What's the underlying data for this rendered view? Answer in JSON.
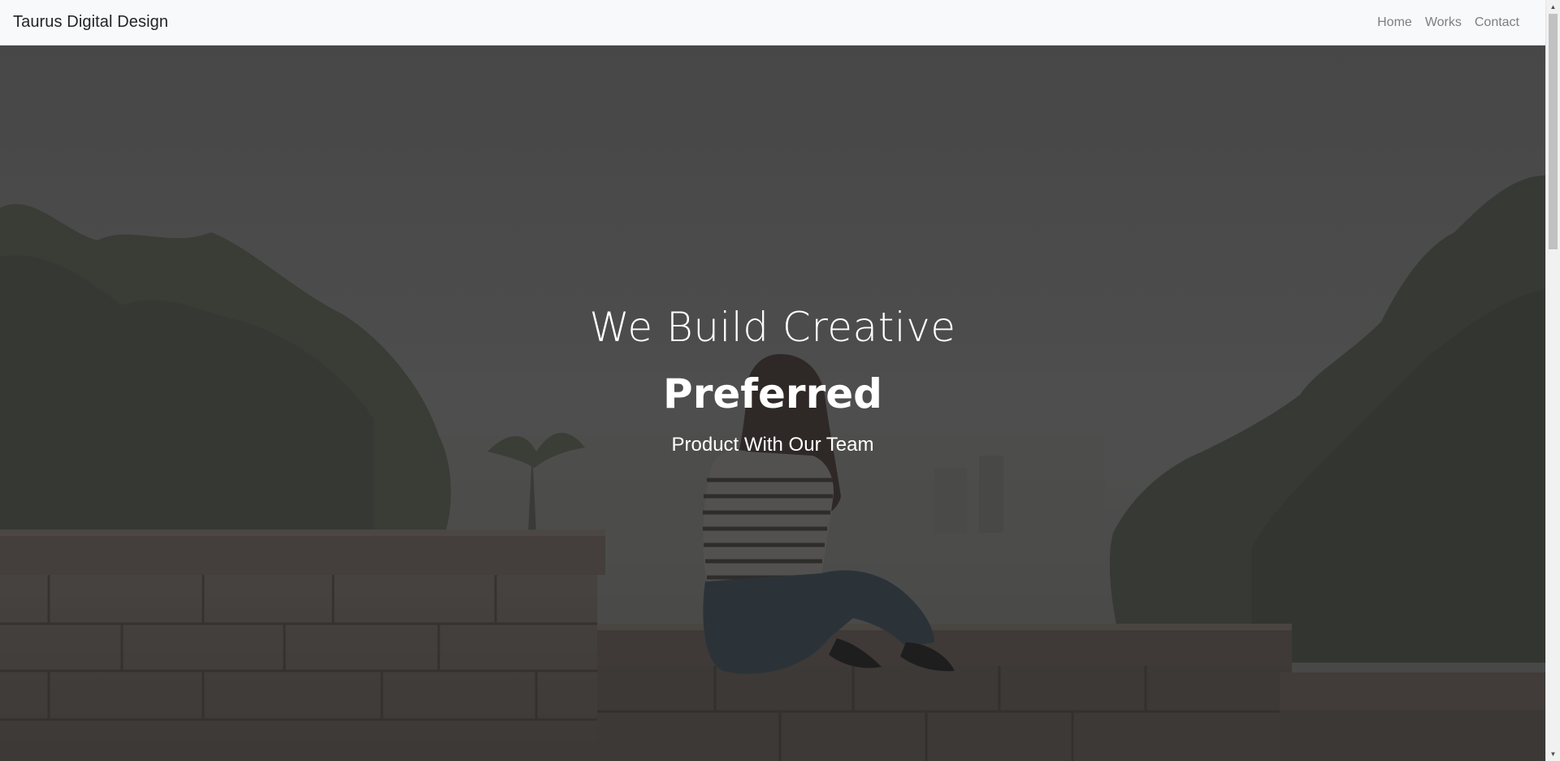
{
  "navbar": {
    "brand": "Taurus Digital Design",
    "links": [
      {
        "label": "Home"
      },
      {
        "label": "Works"
      },
      {
        "label": "Contact"
      }
    ]
  },
  "hero": {
    "line1": "We Build Creative",
    "line2": "Preferred",
    "line3": "Product With Our Team",
    "overlay_color": "#3c3c3c",
    "text_color": "#ffffff"
  },
  "colors": {
    "navbar_bg": "#f8f9fa",
    "brand_text": "#212529",
    "nav_link_text": "#7a7f84"
  },
  "icons": {
    "scroll_up": "arrow-up-icon",
    "scroll_down": "arrow-down-icon"
  }
}
